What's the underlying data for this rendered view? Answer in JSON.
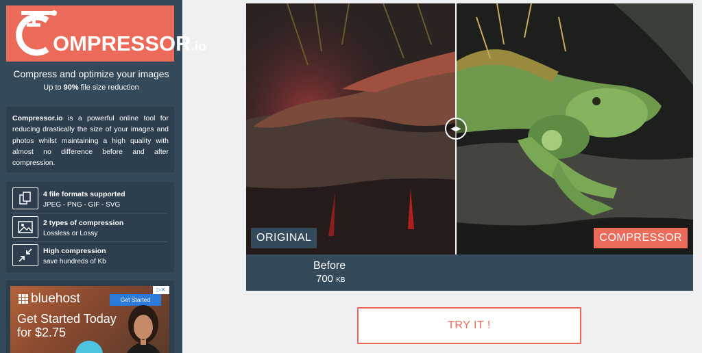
{
  "sidebar": {
    "logo": {
      "text": "OMPRESSOR",
      "suffix": ".io",
      "color": "#ec6a59"
    },
    "tagline": "Compress and optimize your images",
    "sub_tagline_prefix": "Up to ",
    "sub_tagline_bold": "90%",
    "sub_tagline_suffix": " file size reduction",
    "description": {
      "brand": "Compressor.io",
      "text": " is a powerful online tool for reducing drastically the size of your images and photos whilst maintaining a high quality with almost no difference before and after compression."
    },
    "features": [
      {
        "icon": "files-icon",
        "title": "4 file formats supported",
        "subtitle": "JPEG - PNG - GIF - SVG"
      },
      {
        "icon": "image-icon",
        "title": "2 types of compression",
        "subtitle": "Lossless or Lossy"
      },
      {
        "icon": "compress-arrows-icon",
        "title": "High compression",
        "subtitle": "save hundreds of Kb"
      }
    ],
    "ad": {
      "brand": "bluehost",
      "button": "Get Started",
      "headline_1": "Get Started Today",
      "headline_2": "for $2.75"
    }
  },
  "compare": {
    "label_original": "ORIGINAL",
    "label_compressor": "COMPRESSOR",
    "before_title": "Before",
    "before_value": "700",
    "before_unit": "KB"
  },
  "try_button": "TRY IT !",
  "colors": {
    "accent": "#ec6a59",
    "sidebar": "#34495a",
    "panel": "#2d3f4e"
  }
}
